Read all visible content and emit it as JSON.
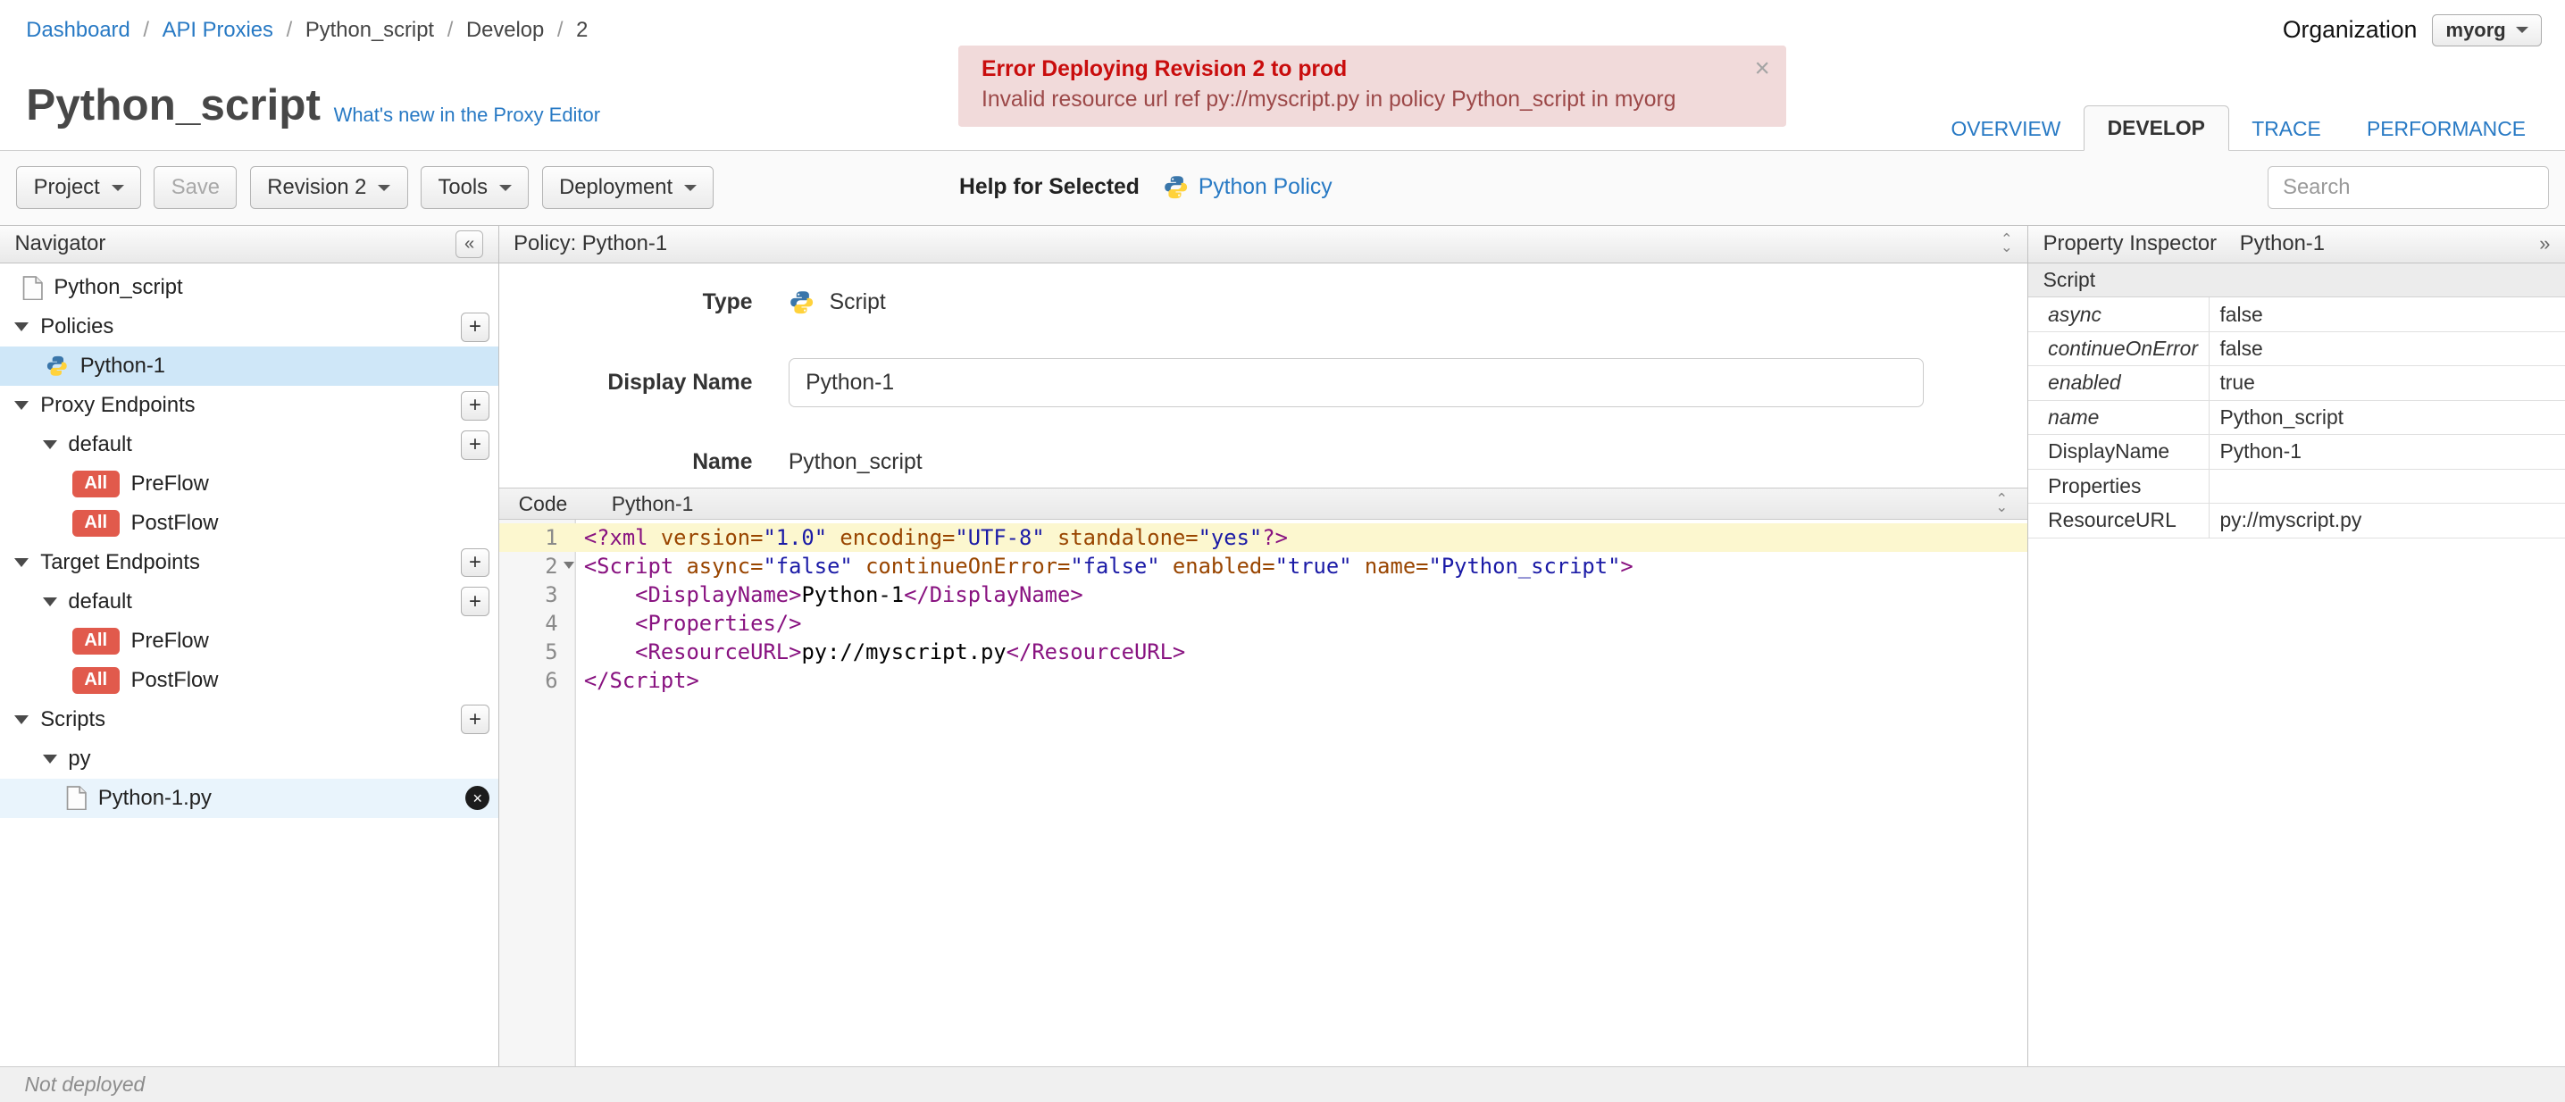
{
  "topbar": {
    "breadcrumb": {
      "separator": "/",
      "items": [
        "Dashboard",
        "API Proxies",
        "Python_script",
        "Develop",
        "2"
      ]
    },
    "organization_label": "Organization",
    "organization_value": "myorg"
  },
  "alert": {
    "title": "Error Deploying Revision 2 to prod",
    "message": "Invalid resource url ref py://myscript.py in policy Python_script in myorg"
  },
  "header": {
    "title": "Python_script",
    "whats_new_link": "What's new in the Proxy Editor"
  },
  "tabs": [
    "OVERVIEW",
    "DEVELOP",
    "TRACE",
    "PERFORMANCE"
  ],
  "toolbar": {
    "project": "Project",
    "save": "Save",
    "revision": "Revision 2",
    "tools": "Tools",
    "deployment": "Deployment",
    "help_for_selected": "Help for Selected",
    "policy_link": "Python Policy",
    "search_placeholder": "Search"
  },
  "navigator": {
    "title": "Navigator",
    "root": "Python_script",
    "sections": {
      "policies": "Policies",
      "proxy_endpoints": "Proxy Endpoints",
      "target_endpoints": "Target Endpoints",
      "scripts": "Scripts"
    },
    "policy": "Python-1",
    "default_endpoint": "default",
    "all_badge": "All",
    "preflow": "PreFlow",
    "postflow": "PostFlow",
    "py_group": "py",
    "script_file": "Python-1.py"
  },
  "policy_panel": {
    "title": "Policy: Python-1",
    "type_label": "Type",
    "type_value": "Script",
    "display_name_label": "Display Name",
    "display_name_value": "Python-1",
    "name_label": "Name",
    "name_value": "Python_script",
    "code_label": "Code",
    "code_file": "Python-1"
  },
  "code": {
    "lines": [
      {
        "no": "1",
        "tokens": [
          "<?xml ",
          "version=",
          "\"1.0\"",
          " encoding=",
          "\"UTF-8\"",
          " standalone=",
          "\"yes\"",
          "?>"
        ]
      },
      {
        "no": "2",
        "tokens": [
          "<Script ",
          "async=",
          "\"false\"",
          " continueOnError=",
          "\"false\"",
          " enabled=",
          "\"true\"",
          " name=",
          "\"Python_script\"",
          ">"
        ]
      },
      {
        "no": "3",
        "tokens": [
          "    ",
          "<DisplayName>",
          "Python-1",
          "</DisplayName>"
        ]
      },
      {
        "no": "4",
        "tokens": [
          "    ",
          "<Properties/>"
        ]
      },
      {
        "no": "5",
        "tokens": [
          "    ",
          "<ResourceURL>",
          "py://myscript.py",
          "</ResourceURL>"
        ]
      },
      {
        "no": "6",
        "tokens": [
          "</Script>"
        ]
      }
    ]
  },
  "inspector": {
    "title": "Property Inspector",
    "subtitle": "Python-1",
    "section": "Script",
    "rows": [
      {
        "label": "async",
        "value": "false"
      },
      {
        "label": "continueOnError",
        "value": "false"
      },
      {
        "label": "enabled",
        "value": "true"
      },
      {
        "label": "name",
        "value": "Python_script"
      },
      {
        "label": "DisplayName",
        "value": "Python-1"
      },
      {
        "label": "Properties",
        "value": ""
      },
      {
        "label": "ResourceURL",
        "value": "py://myscript.py"
      }
    ]
  },
  "statusbar": {
    "text": "Not deployed"
  },
  "icons": {
    "close": "×",
    "collapse_left": "«",
    "expand_right": "»",
    "plus": "+",
    "delete": "×",
    "toggle_up": "⌃",
    "toggle_down": "⌄"
  }
}
